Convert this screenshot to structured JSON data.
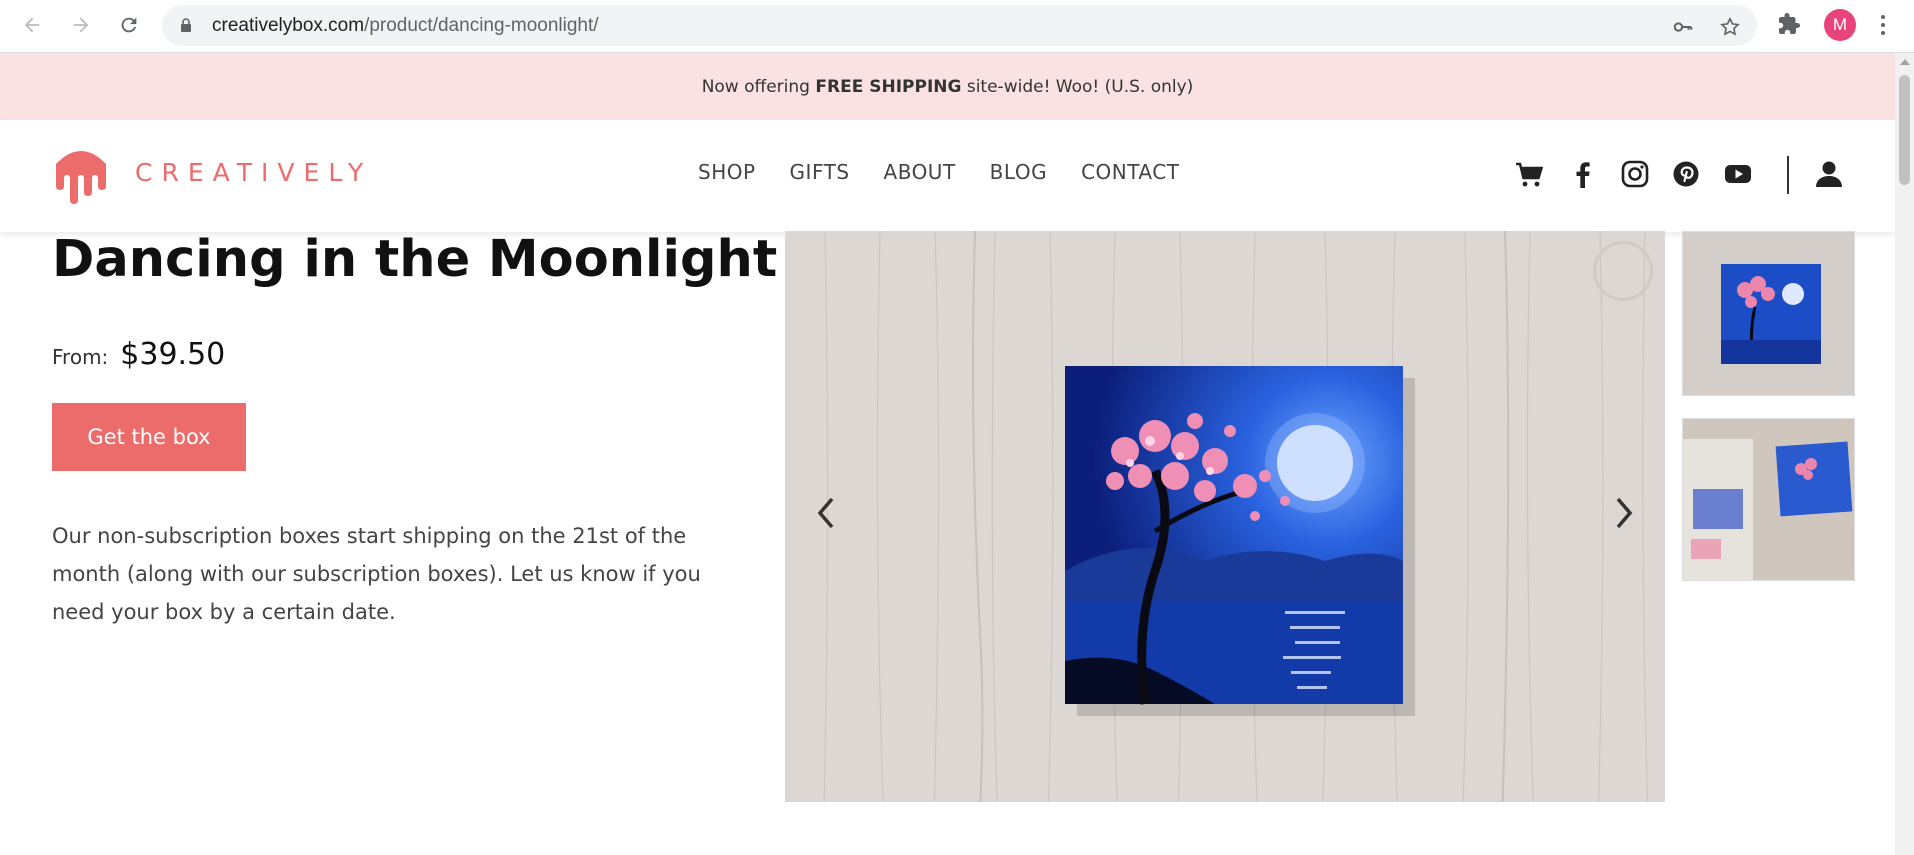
{
  "browser": {
    "url_domain": "creativelybox.com",
    "url_path": "/product/dancing-moonlight/",
    "profile_initial": "M",
    "icons": [
      "back-arrow-icon",
      "forward-arrow-icon",
      "reload-icon",
      "lock-icon",
      "key-icon",
      "star-icon",
      "puzzle-icon",
      "kebab-menu-icon"
    ]
  },
  "promo": {
    "prefix": "Now offering ",
    "bold": "FREE SHIPPING",
    "suffix": " site-wide! Woo! (U.S. only)"
  },
  "header": {
    "logo_text": "CREATIVELY",
    "nav": [
      "SHOP",
      "GIFTS",
      "ABOUT",
      "BLOG",
      "CONTACT"
    ],
    "icons": [
      "cart-icon",
      "facebook-icon",
      "instagram-icon",
      "pinterest-icon",
      "youtube-icon",
      "account-icon"
    ]
  },
  "product": {
    "title": "Dancing in the Moonlight",
    "price_label": "From:",
    "price": "$39.50",
    "cta_label": "Get the box",
    "description": "Our non-subscription boxes start shipping on the 21st of the month (along with our subscription boxes). Let us know if you need your box by a certain date."
  },
  "colors": {
    "brand": "#ec6b6b",
    "promo_bg": "#fae2e2",
    "profile": "#e8437b"
  }
}
